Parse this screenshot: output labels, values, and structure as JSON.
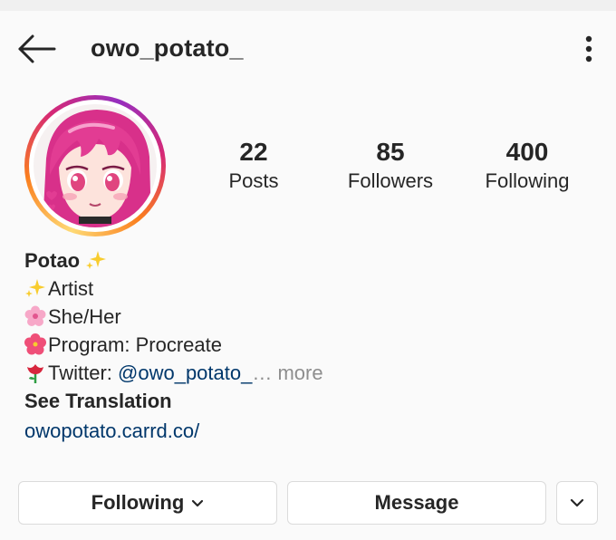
{
  "header": {
    "username": "owo_potato_",
    "back_icon": "arrow-left-icon",
    "menu_icon": "more-vertical-icon"
  },
  "profile": {
    "avatar_icon": "avatar-illustration",
    "stats": [
      {
        "value": "22",
        "label": "Posts"
      },
      {
        "value": "85",
        "label": "Followers"
      },
      {
        "value": "400",
        "label": "Following"
      }
    ]
  },
  "bio": {
    "name": "Potao",
    "name_emoji": "sparkles-emoji",
    "lines": [
      {
        "emoji": "sparkles-emoji",
        "text": "Artist"
      },
      {
        "emoji": "cherry-blossom-emoji",
        "text": "She/Her"
      },
      {
        "emoji": "hibiscus-emoji",
        "text": "Program: Procreate"
      }
    ],
    "twitter_emoji": "rose-emoji",
    "twitter_label": "Twitter: ",
    "twitter_handle": "@owo_potato_",
    "ellipsis": "…",
    "more": " more",
    "see_translation": "See Translation",
    "website": "owopotato.carrd.co/"
  },
  "actions": {
    "following_label": "Following",
    "message_label": "Message"
  },
  "colors": {
    "background": "#fafafa",
    "text": "#262626",
    "link": "#00376b",
    "muted": "#8e8e8e",
    "border": "#dbdbdb"
  }
}
